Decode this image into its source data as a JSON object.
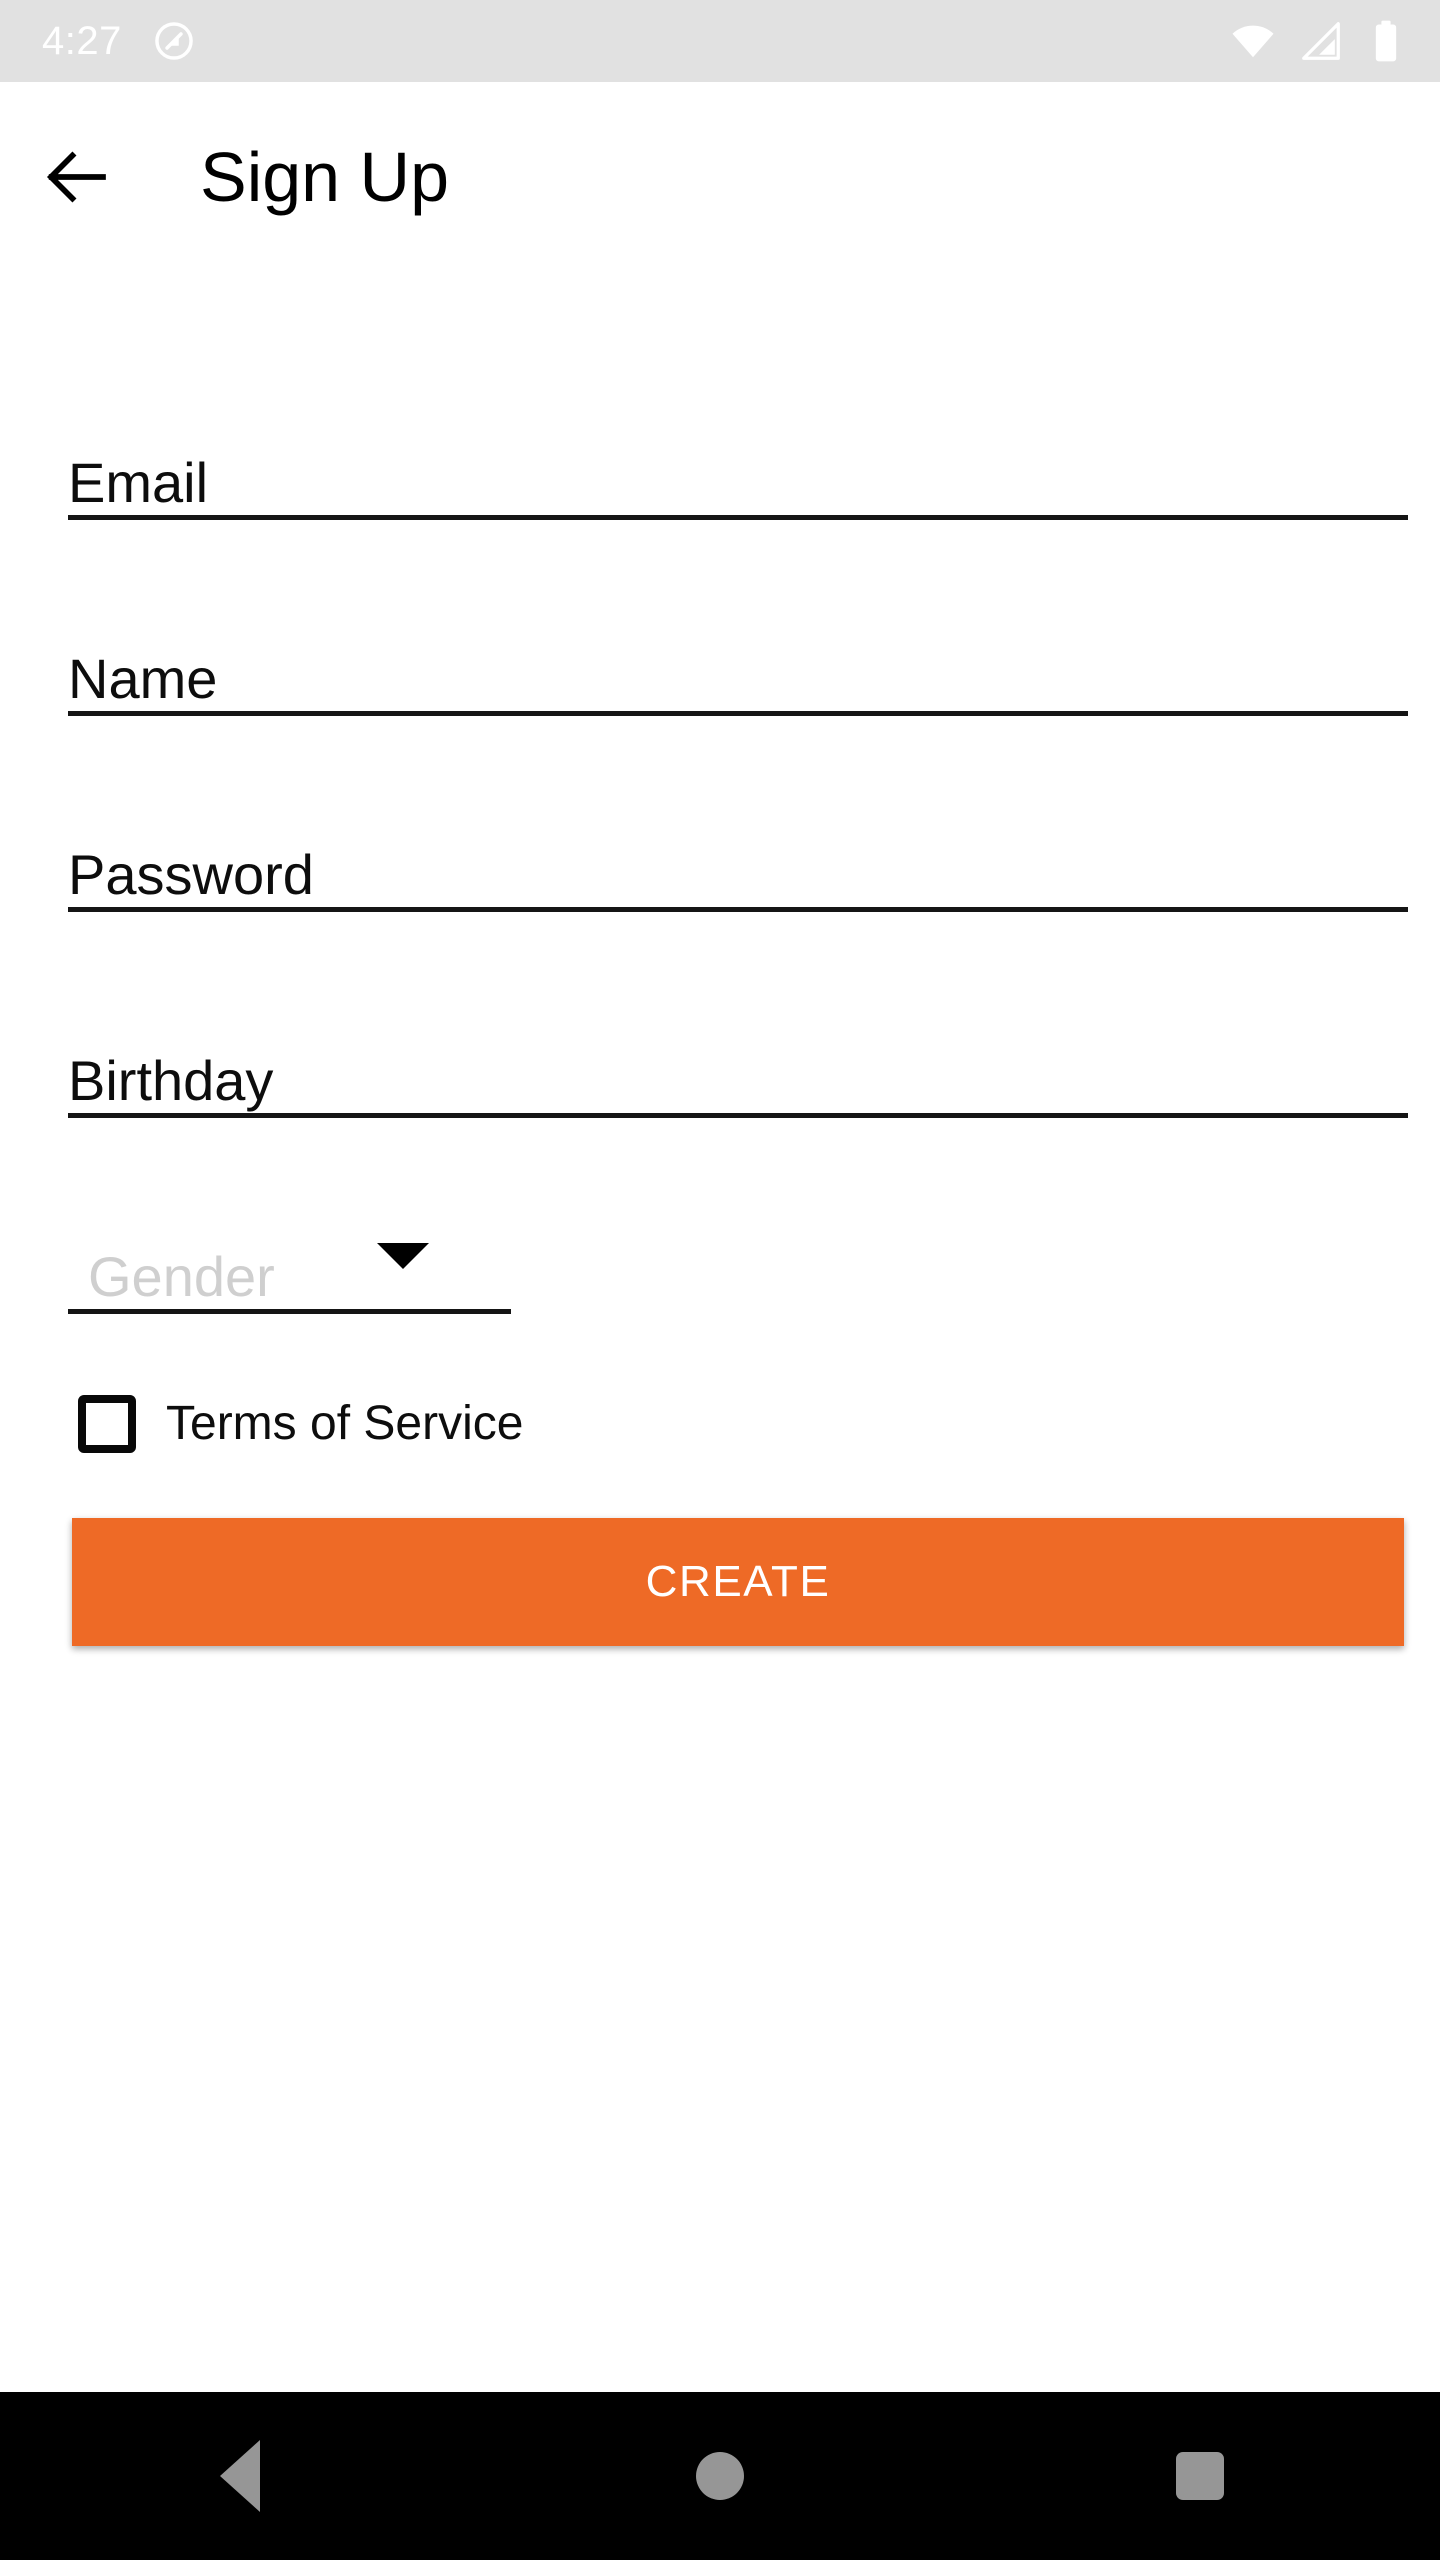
{
  "status_bar": {
    "time": "4:27",
    "background_color": "#E1E1E1",
    "foreground_color": "#FFFFFF",
    "icons": {
      "notification": "do-not-disturb-icon",
      "wifi": "wifi-icon",
      "cellular": "cellular-signal-icon",
      "battery": "battery-full-icon"
    }
  },
  "app_bar": {
    "title": "Sign Up",
    "back_icon": "arrow-left-icon"
  },
  "form": {
    "fields": [
      {
        "name": "email",
        "label": "Email",
        "value": "Email"
      },
      {
        "name": "name",
        "label": "Name",
        "value": "Name"
      },
      {
        "name": "password",
        "label": "Password",
        "value": "Password"
      },
      {
        "name": "birthday",
        "label": "Birthday",
        "value": "Birthday"
      }
    ],
    "gender": {
      "label": "Gender",
      "placeholder": "Gender",
      "selected": "",
      "icon": "chevron-down-icon",
      "placeholder_color": "#CFCFCF"
    },
    "terms": {
      "label": "Terms of Service",
      "checked": false
    },
    "submit": {
      "label": "CREATE",
      "background_color": "#EE6A26",
      "text_color": "#FFFFFF"
    }
  },
  "nav_bar": {
    "background_color": "#000000",
    "icon_color": "#969696",
    "buttons": [
      {
        "name": "back",
        "icon": "triangle-back-icon"
      },
      {
        "name": "home",
        "icon": "circle-home-icon"
      },
      {
        "name": "recents",
        "icon": "square-recents-icon"
      }
    ]
  }
}
